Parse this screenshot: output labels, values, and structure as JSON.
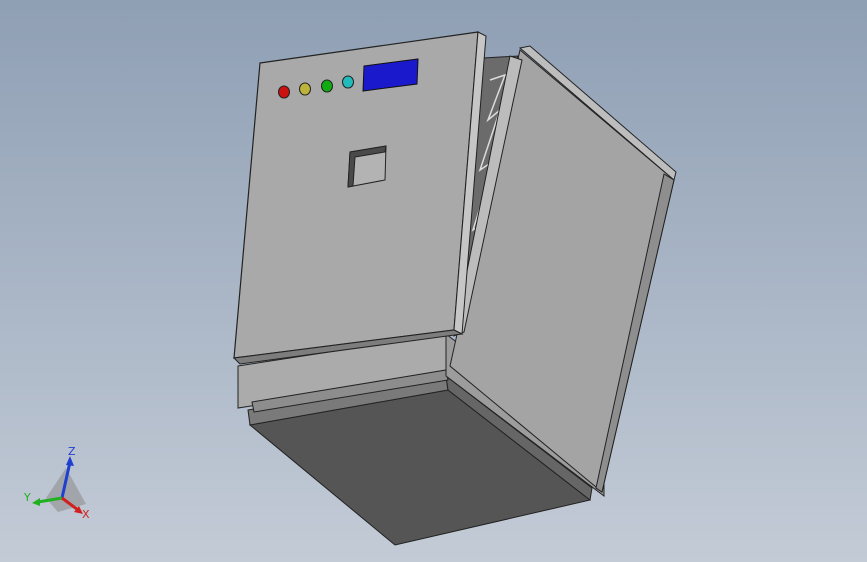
{
  "viewport": {
    "background_top": "#8f9fb4",
    "background_bottom": "#c3cbd6"
  },
  "model": {
    "body_color": "#a9a9a9",
    "side_color": "#9a9a9a",
    "base_color": "#555555",
    "indicators": [
      {
        "name": "red-indicator",
        "color": "#cc1111"
      },
      {
        "name": "yellow-indicator",
        "color": "#bcb33a"
      },
      {
        "name": "green-indicator",
        "color": "#11aa11"
      },
      {
        "name": "cyan-indicator",
        "color": "#22bbbb"
      }
    ],
    "display_color": "#1a1acc"
  },
  "triad": {
    "z_label": "Z",
    "y_label": "Y",
    "x_label": "X",
    "z_color": "#1f3fd0",
    "y_color": "#20b020",
    "x_color": "#d02020"
  }
}
